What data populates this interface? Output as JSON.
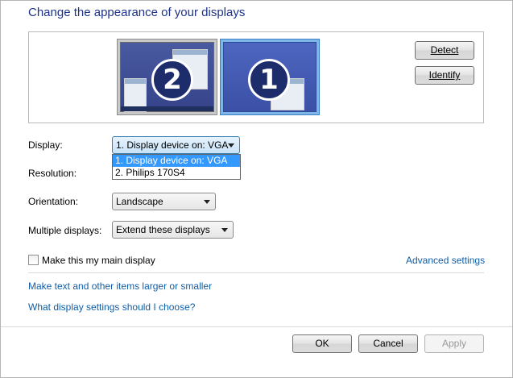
{
  "header": {
    "title": "Change the appearance of your displays"
  },
  "preview": {
    "monitors": [
      {
        "number": "2",
        "selected": false
      },
      {
        "number": "1",
        "selected": true
      }
    ],
    "detect_label": "Detect",
    "identify_label": "Identify"
  },
  "form": {
    "display": {
      "label": "Display:",
      "value": "1. Display device on: VGA",
      "options": [
        "1. Display device on: VGA",
        "2. Philips 170S4"
      ]
    },
    "resolution": {
      "label": "Resolution:"
    },
    "orientation": {
      "label": "Orientation:",
      "value": "Landscape"
    },
    "multiple": {
      "label": "Multiple displays:",
      "value": "Extend these displays"
    },
    "main_display": {
      "label": "Make this my main display",
      "checked": false
    },
    "advanced_link": "Advanced settings"
  },
  "links": {
    "text_size": "Make text and other items larger or smaller",
    "help": "What display settings should I choose?"
  },
  "footer": {
    "ok_label": "OK",
    "cancel_label": "Cancel",
    "apply_label": "Apply"
  },
  "colors": {
    "title": "#1e3287",
    "link": "#0f5ea8",
    "selection": "#3399ff"
  }
}
